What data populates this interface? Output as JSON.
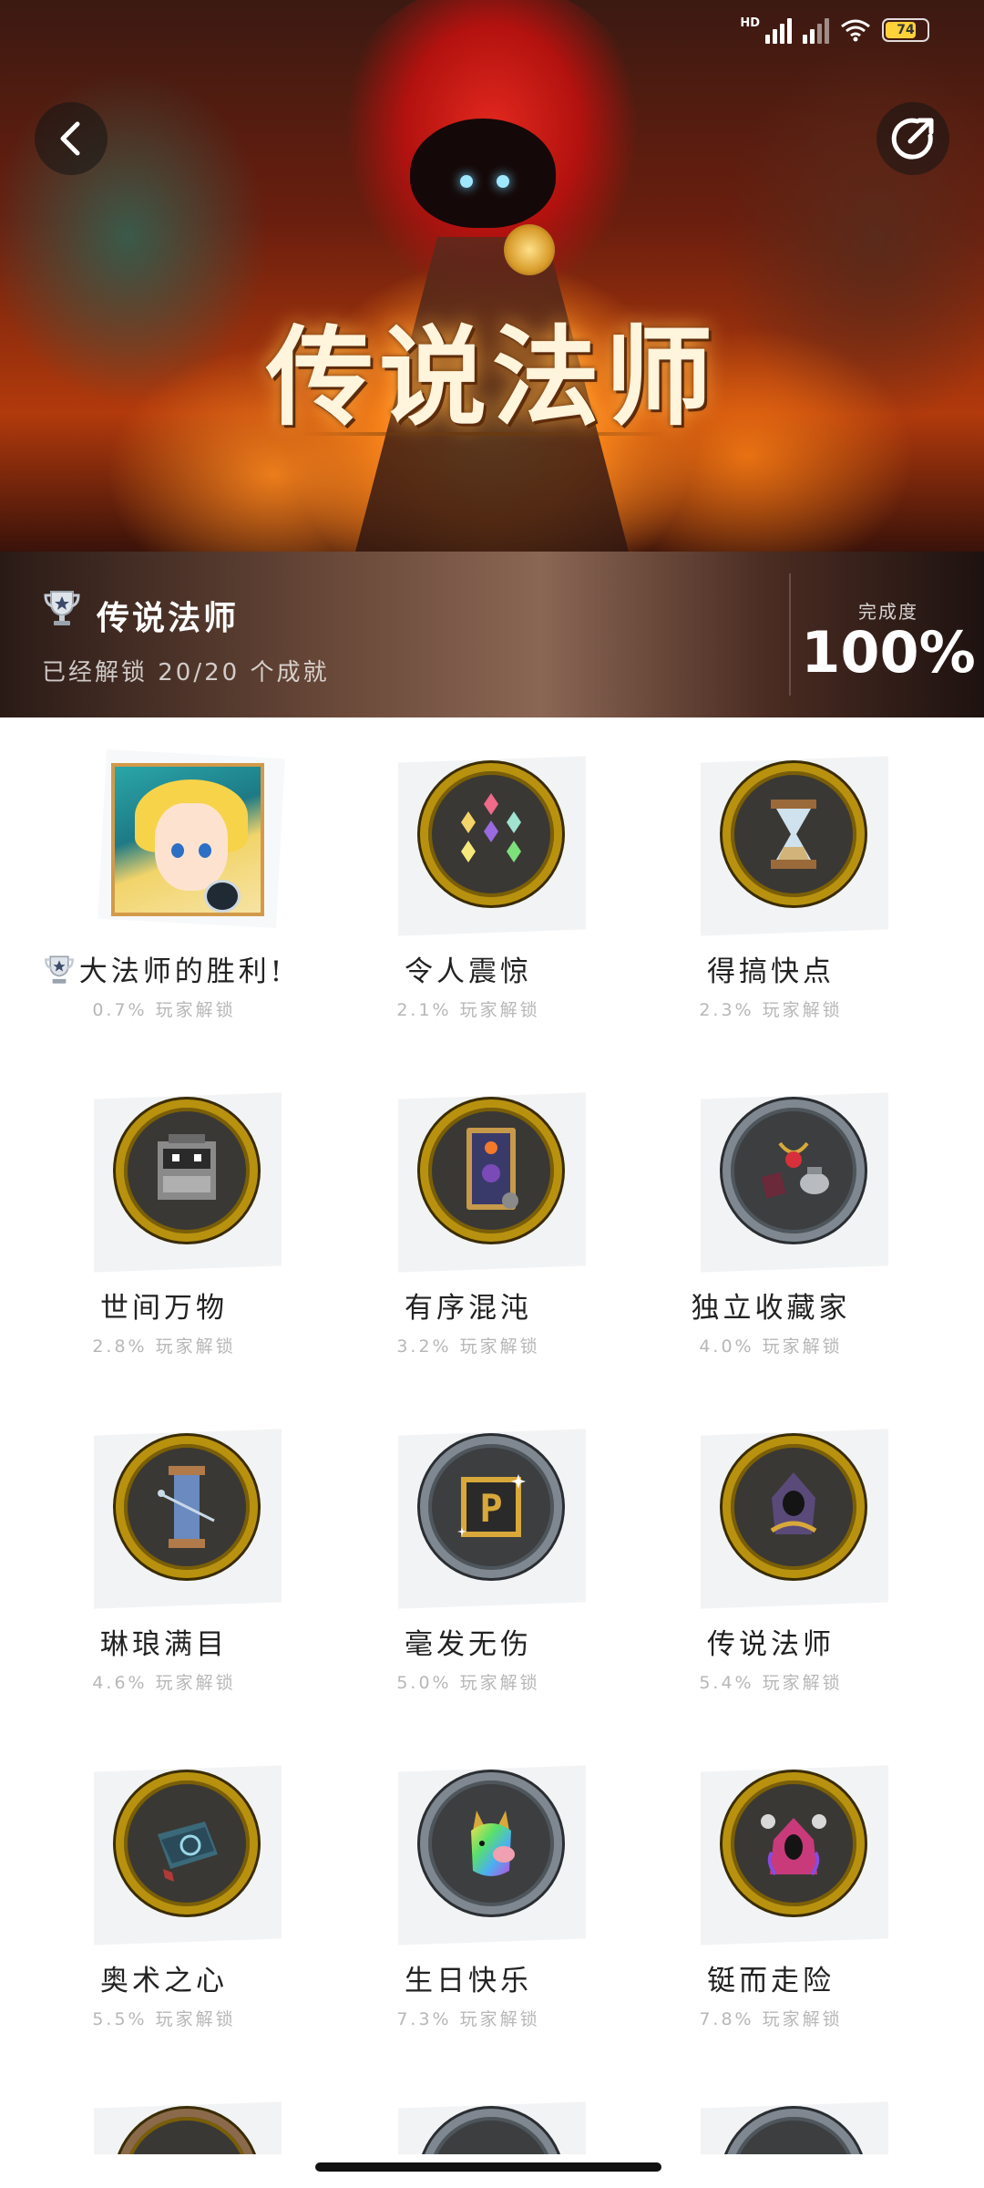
{
  "status_bar": {
    "network": "HD",
    "battery": "74"
  },
  "header": {
    "back_icon": "chevron-left-icon",
    "share_icon": "share-icon",
    "game_title": "传说法师"
  },
  "summary": {
    "title": "传说法师",
    "unlocked_text": "已经解锁 20/20 个成就",
    "completion_label": "完成度",
    "completion_value": "100%",
    "completion_fraction": 1.0
  },
  "achievements": [
    {
      "name": "大法师的胜利!",
      "percent": "0.7% 玩家解锁",
      "icon": "portrait",
      "trophy": true
    },
    {
      "name": "令人震惊",
      "percent": "2.1% 玩家解锁",
      "icon": "gems-icon",
      "trophy": false
    },
    {
      "name": "得搞快点",
      "percent": "2.3% 玩家解锁",
      "icon": "hourglass-icon",
      "trophy": false
    },
    {
      "name": "世间万物",
      "percent": "2.8% 玩家解锁",
      "icon": "chest-icon",
      "trophy": false
    },
    {
      "name": "有序混沌",
      "percent": "3.2% 玩家解锁",
      "icon": "card-icon",
      "trophy": false
    },
    {
      "name": "独立收藏家",
      "percent": "4.0% 玩家解锁",
      "icon": "relics-icon",
      "trophy": false
    },
    {
      "name": "琳琅满目",
      "percent": "4.6% 玩家解锁",
      "icon": "spool-icon",
      "trophy": false
    },
    {
      "name": "毫发无伤",
      "percent": "5.0% 玩家解锁",
      "icon": "p-block-icon",
      "trophy": false
    },
    {
      "name": "传说法师",
      "percent": "5.4% 玩家解锁",
      "icon": "hooded-wizard-icon",
      "trophy": false
    },
    {
      "name": "奥术之心",
      "percent": "5.5% 玩家解锁",
      "icon": "spellbook-icon",
      "trophy": false
    },
    {
      "name": "生日快乐",
      "percent": "7.3% 玩家解锁",
      "icon": "unicorn-icon",
      "trophy": false
    },
    {
      "name": "铤而走险",
      "percent": "7.8% 玩家解锁",
      "icon": "skull-mage-icon",
      "trophy": false
    }
  ],
  "colors": {
    "gold_rim": "#b8920e",
    "silver_rim": "#7f8890",
    "percent_text": "#b7b7b7"
  }
}
